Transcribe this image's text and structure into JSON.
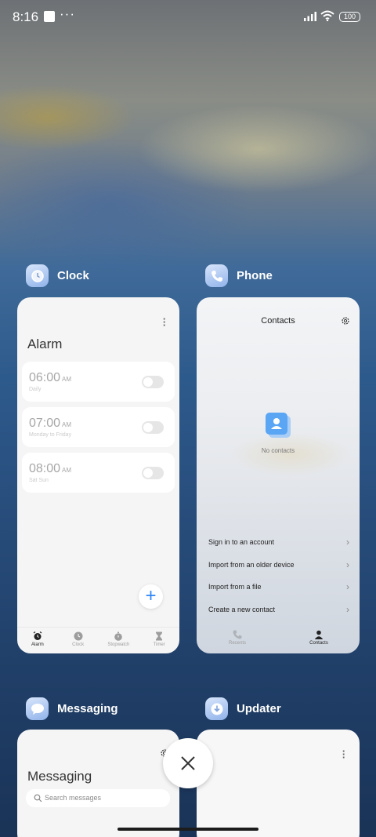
{
  "status_bar": {
    "time": "8:16",
    "more": "···",
    "battery": "100"
  },
  "apps": {
    "clock": {
      "name": "Clock",
      "icon": "clock-icon"
    },
    "phone": {
      "name": "Phone",
      "icon": "phone-icon"
    },
    "messaging": {
      "name": "Messaging",
      "icon": "chat-bubble-icon"
    },
    "updater": {
      "name": "Updater",
      "icon": "download-icon"
    }
  },
  "clock_card": {
    "title": "Alarm",
    "alarms": [
      {
        "time": "06:00",
        "ampm": "AM",
        "repeat": "Daily",
        "enabled": false
      },
      {
        "time": "07:00",
        "ampm": "AM",
        "repeat": "Monday to Friday",
        "enabled": false
      },
      {
        "time": "08:00",
        "ampm": "AM",
        "repeat": "Sat Sun",
        "enabled": false
      }
    ],
    "add_label": "+",
    "nav": [
      {
        "label": "Alarm",
        "icon": "alarm-icon",
        "active": true
      },
      {
        "label": "Clock",
        "icon": "clock-icon",
        "active": false
      },
      {
        "label": "Stopwatch",
        "icon": "stopwatch-icon",
        "active": false
      },
      {
        "label": "Timer",
        "icon": "hourglass-icon",
        "active": false
      }
    ]
  },
  "phone_card": {
    "title": "Contacts",
    "empty_text": "No contacts",
    "options": [
      "Sign in to an account",
      "Import from an older device",
      "Import from a file",
      "Create a new contact"
    ],
    "nav": [
      {
        "label": "Recents",
        "icon": "phone-icon",
        "active": false
      },
      {
        "label": "Contacts",
        "icon": "person-icon",
        "active": true
      }
    ]
  },
  "messaging_card": {
    "title": "Messaging",
    "search_placeholder": "Search messages"
  },
  "colors": {
    "accent": "#2f86f6",
    "card_bg": "#f5f5f5",
    "contact_blue": "#5aa6f4"
  }
}
